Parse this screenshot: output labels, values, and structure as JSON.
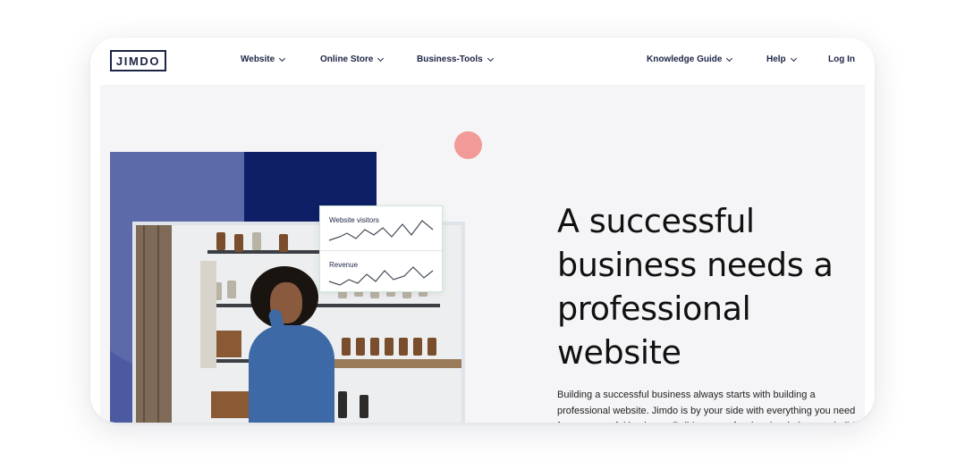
{
  "nav": {
    "logo": "JIMDO",
    "items": [
      {
        "label": "Website",
        "has_dropdown": true
      },
      {
        "label": "Online Store",
        "has_dropdown": true
      },
      {
        "label": "Business-Tools",
        "has_dropdown": true
      },
      {
        "label": "Knowledge Guide",
        "has_dropdown": true
      },
      {
        "label": "Help",
        "has_dropdown": true
      }
    ],
    "login_label": "Log In"
  },
  "hero": {
    "headline_lines": [
      "A successful",
      "business needs a",
      "professional",
      "website"
    ],
    "body": "Building a successful business always starts with building a professional website. Jimdo is by your side with everything you need for a successful business. Build your professional website now, build your success."
  },
  "stats_card": {
    "visitors_label": "Website visitors",
    "revenue_label": "Revenue"
  },
  "colors": {
    "navy": "#1d2445",
    "blue_panel": "#4b5aa1",
    "dark_blue": "#0f1f66",
    "accent_pink": "#f29a98",
    "hero_bg": "#f5f5f7"
  },
  "icons": {
    "dropdown": "chevron-down-icon"
  }
}
